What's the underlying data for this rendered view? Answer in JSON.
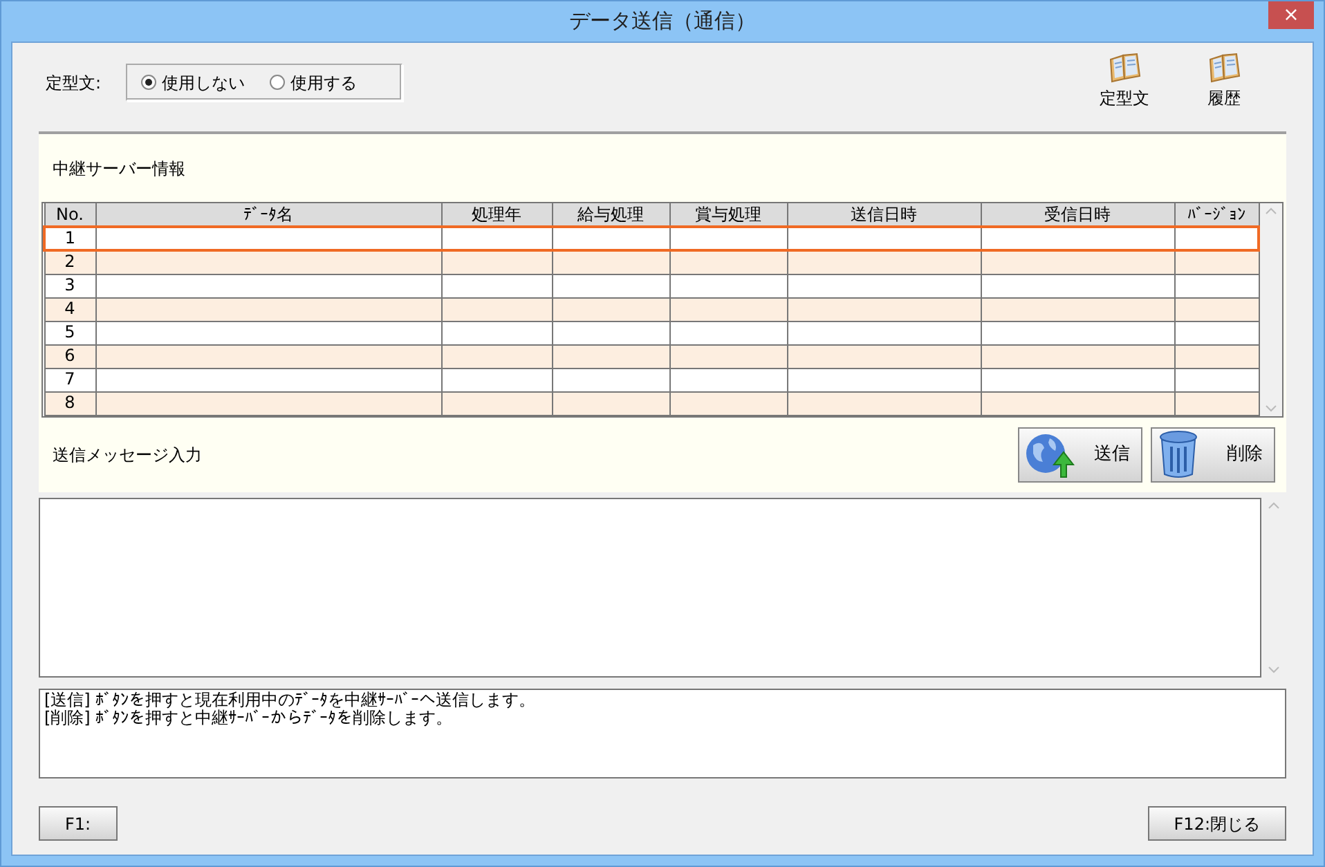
{
  "window": {
    "title": "データ送信（通信）",
    "close": "×"
  },
  "template_option": {
    "label": "定型文:",
    "options": [
      {
        "label": "使用しない",
        "selected": true
      },
      {
        "label": "使用する",
        "selected": false
      }
    ]
  },
  "toolbar": [
    {
      "label": "定型文"
    },
    {
      "label": "履歴"
    }
  ],
  "relay_info": {
    "title": "中継サーバー情報",
    "columns": [
      "No.",
      "ﾃﾞｰﾀ名",
      "処理年",
      "給与処理",
      "賞与処理",
      "送信日時",
      "受信日時",
      "ﾊﾞｰｼﾞｮﾝ"
    ],
    "rows": [
      {
        "no": "1",
        "selected": true
      },
      {
        "no": "2",
        "selected": false
      },
      {
        "no": "3",
        "selected": false
      },
      {
        "no": "4",
        "selected": false
      },
      {
        "no": "5",
        "selected": false
      },
      {
        "no": "6",
        "selected": false
      },
      {
        "no": "7",
        "selected": false
      },
      {
        "no": "8",
        "selected": false
      }
    ]
  },
  "message": {
    "title": "送信メッセージ入力",
    "buttons": [
      {
        "kind": "send",
        "label": "送信"
      },
      {
        "kind": "delete",
        "label": "削除"
      }
    ]
  },
  "info": [
    "[送信] ﾎﾞﾀﾝを押すと現在利用中のﾃﾞｰﾀを中継ｻｰﾊﾞｰへ送信します。",
    "[削除] ﾎﾞﾀﾝを押すと中継ｻｰﾊﾞｰからﾃﾞｰﾀを削除します。"
  ],
  "footer_buttons": [
    "F1:",
    "F12:閉じる"
  ]
}
